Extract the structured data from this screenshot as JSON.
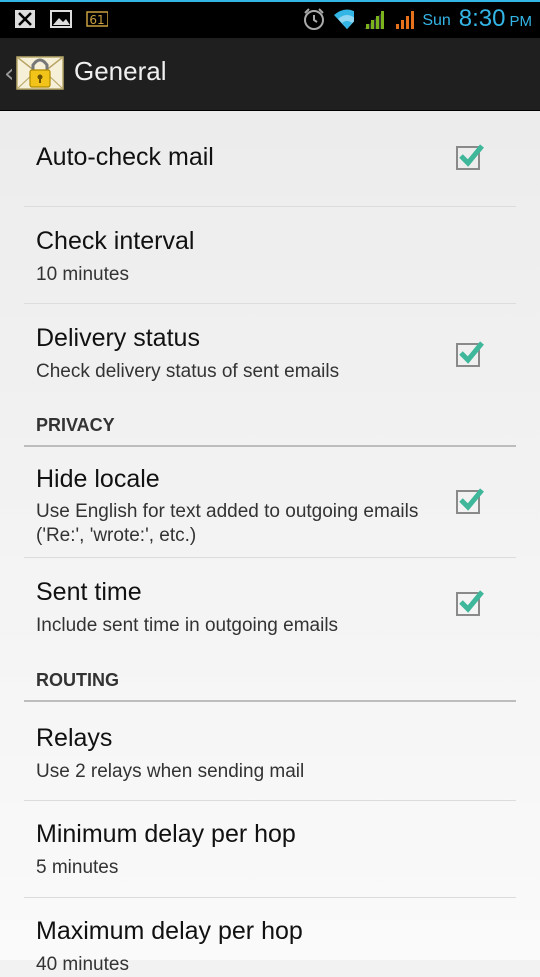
{
  "status_bar": {
    "icons": [
      "usb-debug-icon",
      "image-icon",
      "battery-level-icon",
      "alarm-icon",
      "wifi-icon",
      "signal-green-icon",
      "signal-orange-icon"
    ],
    "battery_text": "61",
    "day": "Sun",
    "time": "8:30",
    "ampm": "PM",
    "accent": "#33b5e5"
  },
  "action_bar": {
    "title": "General",
    "icon": "envelope-lock-icon"
  },
  "preferences": [
    {
      "title": "Auto-check mail",
      "checked": true
    },
    {
      "title": "Check interval",
      "summary": "10 minutes"
    },
    {
      "title": "Delivery status",
      "summary": "Check delivery status of sent emails",
      "checked": true
    }
  ],
  "privacy": {
    "header": "PRIVACY",
    "items": [
      {
        "title": "Hide locale",
        "summary": "Use English for text added to outgoing emails ('Re:', 'wrote:', etc.)",
        "checked": true
      },
      {
        "title": "Sent time",
        "summary": "Include sent time in outgoing emails",
        "checked": true
      }
    ]
  },
  "routing": {
    "header": "ROUTING",
    "items": [
      {
        "title": "Relays",
        "summary": "Use 2 relays when sending mail"
      },
      {
        "title": "Minimum delay per hop",
        "summary": "5 minutes"
      },
      {
        "title": "Maximum delay per hop",
        "summary": "40 minutes"
      }
    ]
  },
  "check_color": "#3fb79a"
}
